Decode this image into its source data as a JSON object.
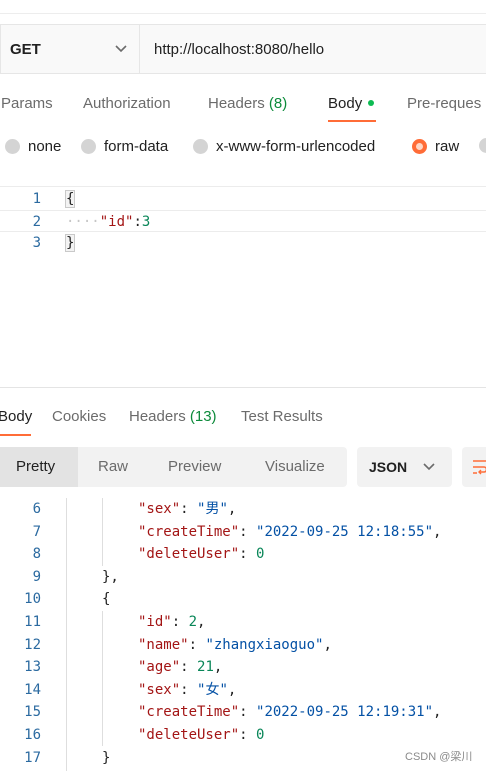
{
  "request": {
    "method": "GET",
    "url": "http://localhost:8080/hello"
  },
  "request_tabs": [
    {
      "label": "Params"
    },
    {
      "label": "Authorization"
    },
    {
      "label": "Headers",
      "count": "(8)"
    },
    {
      "label": "Body"
    },
    {
      "label": "Pre-reques"
    }
  ],
  "body_types": [
    "none",
    "form-data",
    "x-www-form-urlencoded",
    "raw"
  ],
  "body_type_selected": "raw",
  "request_body_lines": [
    {
      "n": "1",
      "text": "{"
    },
    {
      "n": "2",
      "key": "\"id\"",
      "value": "3"
    },
    {
      "n": "3",
      "text": "}"
    }
  ],
  "response_tabs": [
    {
      "label": "Body"
    },
    {
      "label": "Cookies"
    },
    {
      "label": "Headers",
      "count": "(13)"
    },
    {
      "label": "Test Results"
    }
  ],
  "view_modes": [
    "Pretty",
    "Raw",
    "Preview",
    "Visualize"
  ],
  "format": "JSON",
  "response_lines": [
    {
      "n": "6",
      "key": "\"sex\"",
      "value": "\"男\"",
      "end": ","
    },
    {
      "n": "7",
      "key": "\"createTime\"",
      "value": "\"2022-09-25 12:18:55\"",
      "end": ","
    },
    {
      "n": "8",
      "key": "\"deleteUser\"",
      "value": "0",
      "end": ""
    },
    {
      "n": "9",
      "text": "},"
    },
    {
      "n": "10",
      "text": "{"
    },
    {
      "n": "11",
      "key": "\"id\"",
      "value": "2",
      "end": ","
    },
    {
      "n": "12",
      "key": "\"name\"",
      "value": "\"zhangxiaoguo\"",
      "end": ","
    },
    {
      "n": "13",
      "key": "\"age\"",
      "value": "21",
      "end": ","
    },
    {
      "n": "14",
      "key": "\"sex\"",
      "value": "\"女\"",
      "end": ","
    },
    {
      "n": "15",
      "key": "\"createTime\"",
      "value": "\"2022-09-25 12:19:31\"",
      "end": ","
    },
    {
      "n": "16",
      "key": "\"deleteUser\"",
      "value": "0",
      "end": ""
    },
    {
      "n": "17",
      "text": "}"
    }
  ],
  "watermark": "CSDN @梁川",
  "colors": {
    "accent": "#ff6c37",
    "count_green": "#0c8a3a",
    "dot_green": "#0cbb52"
  }
}
